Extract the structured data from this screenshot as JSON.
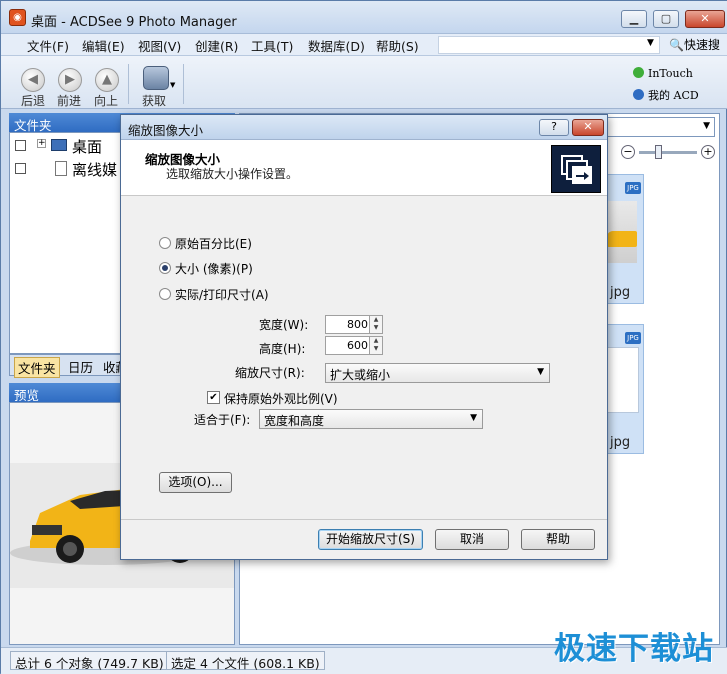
{
  "window": {
    "title": "桌面 - ACDSee 9 Photo Manager",
    "icon": "acdsee-app-icon"
  },
  "menu": {
    "items": [
      "文件(F)",
      "编辑(E)",
      "视图(V)",
      "创建(R)",
      "工具(T)",
      "数据库(D)",
      "帮助(S)"
    ],
    "quick_search": "快速搜"
  },
  "toolbar": {
    "back": "后退",
    "forward": "前进",
    "up": "向上",
    "acquire": "获取",
    "intouch": "InTouch",
    "myacd": "我的 ACD"
  },
  "folders": {
    "header": "文件夹",
    "tree": [
      "桌面",
      "离线媒"
    ],
    "tabs": [
      "文件夹",
      "日历",
      "收藏"
    ]
  },
  "preview": {
    "header": "预览"
  },
  "thumbnails": [
    {
      "ext": "jpg",
      "badge": "JPG"
    },
    {
      "ext": "jpg",
      "badge": "JPG"
    }
  ],
  "status": {
    "total": "总计 6 个对象 (749.7 KB)",
    "selected": "选定 4 个文件 (608.1 KB)"
  },
  "watermark": "极速下载站",
  "dialog": {
    "title": "缩放图像大小",
    "heading": "缩放图像大小",
    "subheading": "选取缩放大小操作设置。",
    "help_btn": "?",
    "close_btn": "✕",
    "radio_options": [
      "原始百分比(E)",
      "大小 (像素)(P)",
      "实际/打印尺寸(A)"
    ],
    "selected_radio": 1,
    "width_label": "宽度(W):",
    "width_value": "800",
    "height_label": "高度(H):",
    "height_value": "600",
    "resize_label": "缩放尺寸(R):",
    "resize_value": "扩大或缩小",
    "keep_aspect_label": "保持原始外观比例(V)",
    "keep_aspect_checked": true,
    "fit_label": "适合于(F):",
    "fit_value": "宽度和高度",
    "options_btn": "选项(O)...",
    "start_btn": "开始缩放尺寸(S)",
    "cancel_btn": "取消",
    "help_button": "帮助"
  }
}
